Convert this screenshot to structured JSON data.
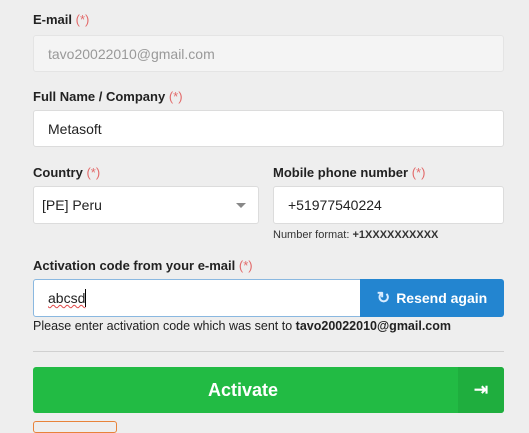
{
  "email": {
    "label": "E-mail",
    "required": "(*)",
    "value": "tavo20022010@gmail.com"
  },
  "name": {
    "label": "Full Name / Company",
    "required": "(*)",
    "value": "Metasoft"
  },
  "country": {
    "label": "Country",
    "required": "(*)",
    "value": "[PE] Peru"
  },
  "phone": {
    "label": "Mobile phone number",
    "required": "(*)",
    "value": "+51977540224",
    "hint_prefix": "Number format:",
    "hint_format": "+1XXXXXXXXXX"
  },
  "activation": {
    "label": "Activation code from your e-mail",
    "required": "(*)",
    "value": "abcsd",
    "resend_label": "Resend again",
    "help_prefix": "Please enter activation code which was sent to",
    "help_email": "tavo20022010@gmail.com"
  },
  "activate_label": "Activate",
  "colors": {
    "blue": "#2385d0",
    "green": "#22bb44",
    "required": "#e04848"
  }
}
